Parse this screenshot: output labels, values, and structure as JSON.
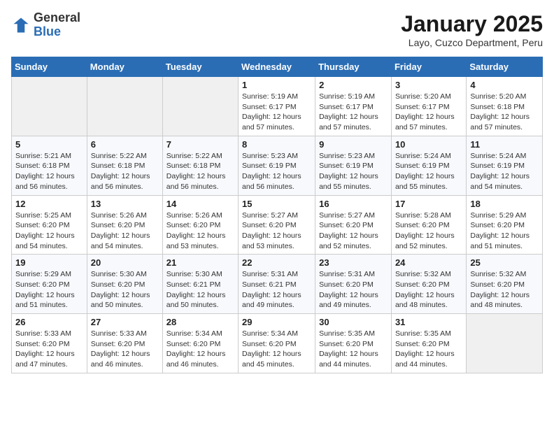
{
  "logo": {
    "general": "General",
    "blue": "Blue"
  },
  "header": {
    "month": "January 2025",
    "location": "Layo, Cuzco Department, Peru"
  },
  "weekdays": [
    "Sunday",
    "Monday",
    "Tuesday",
    "Wednesday",
    "Thursday",
    "Friday",
    "Saturday"
  ],
  "weeks": [
    [
      {
        "day": "",
        "info": ""
      },
      {
        "day": "",
        "info": ""
      },
      {
        "day": "",
        "info": ""
      },
      {
        "day": "1",
        "info": "Sunrise: 5:19 AM\nSunset: 6:17 PM\nDaylight: 12 hours\nand 57 minutes."
      },
      {
        "day": "2",
        "info": "Sunrise: 5:19 AM\nSunset: 6:17 PM\nDaylight: 12 hours\nand 57 minutes."
      },
      {
        "day": "3",
        "info": "Sunrise: 5:20 AM\nSunset: 6:17 PM\nDaylight: 12 hours\nand 57 minutes."
      },
      {
        "day": "4",
        "info": "Sunrise: 5:20 AM\nSunset: 6:18 PM\nDaylight: 12 hours\nand 57 minutes."
      }
    ],
    [
      {
        "day": "5",
        "info": "Sunrise: 5:21 AM\nSunset: 6:18 PM\nDaylight: 12 hours\nand 56 minutes."
      },
      {
        "day": "6",
        "info": "Sunrise: 5:22 AM\nSunset: 6:18 PM\nDaylight: 12 hours\nand 56 minutes."
      },
      {
        "day": "7",
        "info": "Sunrise: 5:22 AM\nSunset: 6:18 PM\nDaylight: 12 hours\nand 56 minutes."
      },
      {
        "day": "8",
        "info": "Sunrise: 5:23 AM\nSunset: 6:19 PM\nDaylight: 12 hours\nand 56 minutes."
      },
      {
        "day": "9",
        "info": "Sunrise: 5:23 AM\nSunset: 6:19 PM\nDaylight: 12 hours\nand 55 minutes."
      },
      {
        "day": "10",
        "info": "Sunrise: 5:24 AM\nSunset: 6:19 PM\nDaylight: 12 hours\nand 55 minutes."
      },
      {
        "day": "11",
        "info": "Sunrise: 5:24 AM\nSunset: 6:19 PM\nDaylight: 12 hours\nand 54 minutes."
      }
    ],
    [
      {
        "day": "12",
        "info": "Sunrise: 5:25 AM\nSunset: 6:20 PM\nDaylight: 12 hours\nand 54 minutes."
      },
      {
        "day": "13",
        "info": "Sunrise: 5:26 AM\nSunset: 6:20 PM\nDaylight: 12 hours\nand 54 minutes."
      },
      {
        "day": "14",
        "info": "Sunrise: 5:26 AM\nSunset: 6:20 PM\nDaylight: 12 hours\nand 53 minutes."
      },
      {
        "day": "15",
        "info": "Sunrise: 5:27 AM\nSunset: 6:20 PM\nDaylight: 12 hours\nand 53 minutes."
      },
      {
        "day": "16",
        "info": "Sunrise: 5:27 AM\nSunset: 6:20 PM\nDaylight: 12 hours\nand 52 minutes."
      },
      {
        "day": "17",
        "info": "Sunrise: 5:28 AM\nSunset: 6:20 PM\nDaylight: 12 hours\nand 52 minutes."
      },
      {
        "day": "18",
        "info": "Sunrise: 5:29 AM\nSunset: 6:20 PM\nDaylight: 12 hours\nand 51 minutes."
      }
    ],
    [
      {
        "day": "19",
        "info": "Sunrise: 5:29 AM\nSunset: 6:20 PM\nDaylight: 12 hours\nand 51 minutes."
      },
      {
        "day": "20",
        "info": "Sunrise: 5:30 AM\nSunset: 6:20 PM\nDaylight: 12 hours\nand 50 minutes."
      },
      {
        "day": "21",
        "info": "Sunrise: 5:30 AM\nSunset: 6:21 PM\nDaylight: 12 hours\nand 50 minutes."
      },
      {
        "day": "22",
        "info": "Sunrise: 5:31 AM\nSunset: 6:21 PM\nDaylight: 12 hours\nand 49 minutes."
      },
      {
        "day": "23",
        "info": "Sunrise: 5:31 AM\nSunset: 6:20 PM\nDaylight: 12 hours\nand 49 minutes."
      },
      {
        "day": "24",
        "info": "Sunrise: 5:32 AM\nSunset: 6:20 PM\nDaylight: 12 hours\nand 48 minutes."
      },
      {
        "day": "25",
        "info": "Sunrise: 5:32 AM\nSunset: 6:20 PM\nDaylight: 12 hours\nand 48 minutes."
      }
    ],
    [
      {
        "day": "26",
        "info": "Sunrise: 5:33 AM\nSunset: 6:20 PM\nDaylight: 12 hours\nand 47 minutes."
      },
      {
        "day": "27",
        "info": "Sunrise: 5:33 AM\nSunset: 6:20 PM\nDaylight: 12 hours\nand 46 minutes."
      },
      {
        "day": "28",
        "info": "Sunrise: 5:34 AM\nSunset: 6:20 PM\nDaylight: 12 hours\nand 46 minutes."
      },
      {
        "day": "29",
        "info": "Sunrise: 5:34 AM\nSunset: 6:20 PM\nDaylight: 12 hours\nand 45 minutes."
      },
      {
        "day": "30",
        "info": "Sunrise: 5:35 AM\nSunset: 6:20 PM\nDaylight: 12 hours\nand 44 minutes."
      },
      {
        "day": "31",
        "info": "Sunrise: 5:35 AM\nSunset: 6:20 PM\nDaylight: 12 hours\nand 44 minutes."
      },
      {
        "day": "",
        "info": ""
      }
    ]
  ]
}
